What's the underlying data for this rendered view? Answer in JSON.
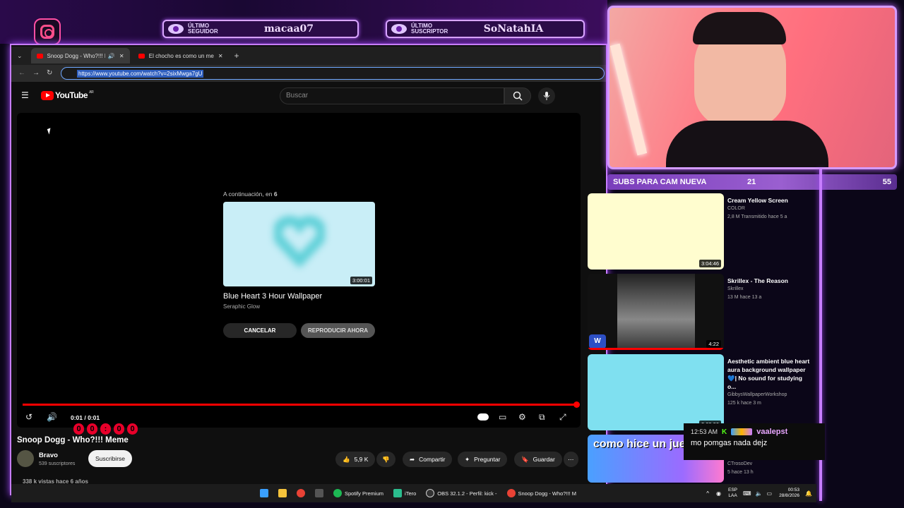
{
  "overlay": {
    "last_follower_label": "ÚLTIMO SEGUIDOR",
    "last_follower_name": "macaa07",
    "last_sub_label": "ÚLTIMO SUSCRIPTOR",
    "last_sub_name": "SoNatahIA",
    "sub_goal_label": "SUBS PARA CAM NUEVA",
    "sub_goal_current": "21",
    "sub_goal_target": "55",
    "accent": "#c77dff"
  },
  "browser": {
    "tabs": [
      {
        "label": "Snoop Dogg - Who?!!! Me"
      },
      {
        "label": "El chocho es como un melocot"
      }
    ],
    "url": "https://www.youtube.com/watch?v=2sixMwga7gU"
  },
  "youtube": {
    "logo_text": "YouTube",
    "region": "AR",
    "search_placeholder": "Buscar",
    "up_next": {
      "label_prefix": "A continuación, en ",
      "countdown": "6",
      "duration": "3:00:01",
      "title": "Blue Heart 3 Hour Wallpaper",
      "channel": "Seraphic Glow",
      "cancel": "CANCELAR",
      "play_now": "REPRODUCIR AHORA"
    },
    "player": {
      "time": "0:01 / 0:01",
      "progress": 1.0,
      "timer_digits": [
        "0",
        "0",
        ":",
        "0",
        "0"
      ]
    },
    "video": {
      "title": "Snoop Dogg - Who?!!! Meme",
      "channel": "Bravo",
      "subs": "539 suscriptores",
      "subscribe": "Suscribirse",
      "likes": "5,9 K",
      "share": "Compartir",
      "ask": "Preguntar",
      "save": "Guardar",
      "views": "338 k vistas  hace 6 años"
    },
    "recommendations": [
      {
        "title": "Cream Yellow Screen",
        "channel": "COLOR",
        "meta": "2,8 M  Transmitido hace 5 a",
        "duration": "3:04:46"
      },
      {
        "title": "Skrillex - The Reason",
        "channel": "Skrillex",
        "meta": "13 M  hace 13 a",
        "duration": "4:22"
      },
      {
        "title": "Aesthetic ambient blue heart aura background wallpaper 💙| No sound for studying o...",
        "channel": "GibbysWallpaperWorkshop",
        "meta": "125 k  hace 3 m",
        "duration": "3:00:00"
      },
      {
        "title": "como hice un juego",
        "channel": "CTrosoDev",
        "meta": "5  hace 13 h",
        "duration": ""
      }
    ]
  },
  "chat": {
    "time": "12:53 AM",
    "user": "vaalepst",
    "message": "mo pomgas nada dejz"
  },
  "taskbar": {
    "items": [
      "Spotify Premium",
      "iTero",
      "OBS 32.1.2 - Perfil: kick -",
      "Snoop Dogg - Who?!!! M"
    ],
    "lang": "ESP",
    "lang2": "LAA",
    "time": "00:53",
    "date": "28/8/2026"
  }
}
